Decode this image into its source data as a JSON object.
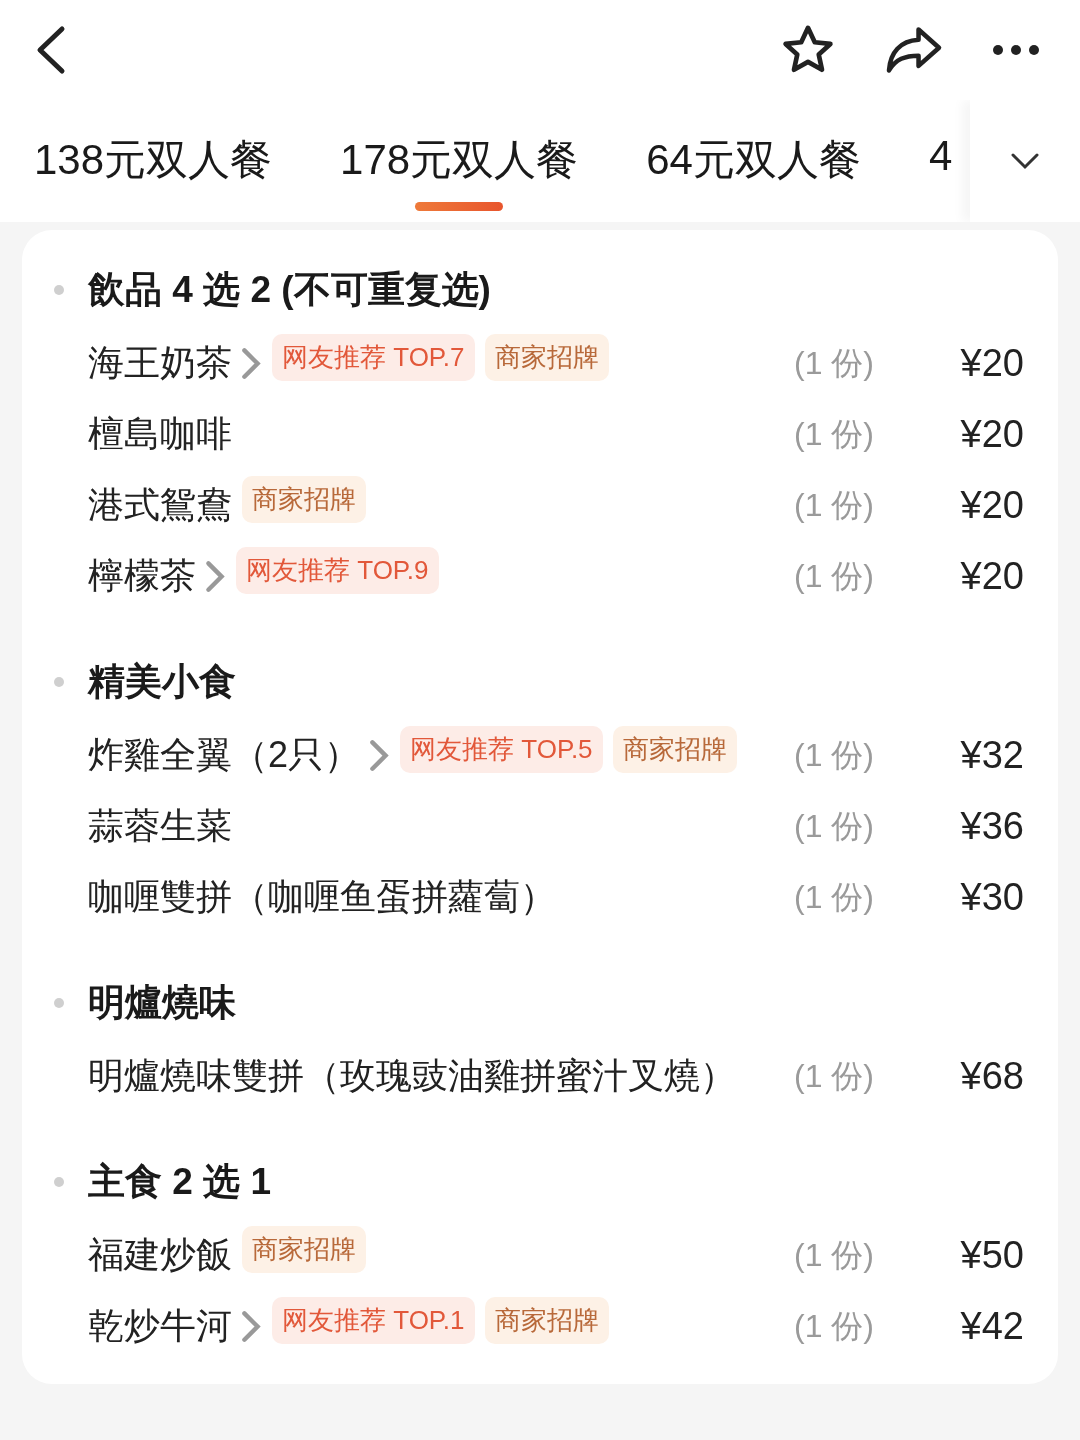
{
  "tabs": [
    {
      "label": "138元双人餐",
      "selected": false
    },
    {
      "label": "178元双人餐",
      "selected": true
    },
    {
      "label": "64元双人餐",
      "selected": false
    },
    {
      "label": "4",
      "selected": false
    }
  ],
  "sections": [
    {
      "title": "飲品 4 选 2 (不可重复选)",
      "items": [
        {
          "name": "海王奶茶",
          "expandable": true,
          "tags": [
            {
              "kind": "rank",
              "label": "网友推荐 TOP.7"
            },
            {
              "kind": "signature",
              "label": "商家招牌"
            }
          ],
          "qty": "(1 份)",
          "price": "¥20"
        },
        {
          "name": "檀島咖啡",
          "expandable": false,
          "qty": "(1 份)",
          "price": "¥20"
        },
        {
          "name": "港式鴛鴦",
          "expandable": false,
          "tags": [
            {
              "kind": "signature",
              "label": "商家招牌"
            }
          ],
          "qty": "(1 份)",
          "price": "¥20"
        },
        {
          "name": "檸檬茶",
          "expandable": true,
          "tags": [
            {
              "kind": "rank",
              "label": "网友推荐 TOP.9"
            }
          ],
          "qty": "(1 份)",
          "price": "¥20"
        }
      ]
    },
    {
      "title": "精美小食",
      "items": [
        {
          "name": "炸雞全翼（2只）",
          "expandable": true,
          "tags": [
            {
              "kind": "rank",
              "label": "网友推荐 TOP.5"
            },
            {
              "kind": "signature",
              "label": "商家招牌"
            }
          ],
          "qty": "(1 份)",
          "price": "¥32"
        },
        {
          "name": "蒜蓉生菜",
          "expandable": false,
          "qty": "(1 份)",
          "price": "¥36"
        },
        {
          "name": "咖喱雙拼（咖喱鱼蛋拼蘿蔔）",
          "expandable": false,
          "qty": "(1 份)",
          "price": "¥30"
        }
      ]
    },
    {
      "title": "明爐燒味",
      "items": [
        {
          "name": "明爐燒味雙拼（玫瑰豉油雞拼蜜汁叉燒）",
          "expandable": false,
          "qty": "(1 份)",
          "price": "¥68"
        }
      ]
    },
    {
      "title": "主食 2 选 1",
      "items": [
        {
          "name": "福建炒飯",
          "expandable": false,
          "tags": [
            {
              "kind": "signature",
              "label": "商家招牌"
            }
          ],
          "qty": "(1 份)",
          "price": "¥50"
        },
        {
          "name": "乾炒牛河",
          "expandable": true,
          "tags": [
            {
              "kind": "rank",
              "label": "网友推荐 TOP.1"
            },
            {
              "kind": "signature",
              "label": "商家招牌"
            }
          ],
          "qty": "(1 份)",
          "price": "¥42"
        }
      ]
    }
  ]
}
